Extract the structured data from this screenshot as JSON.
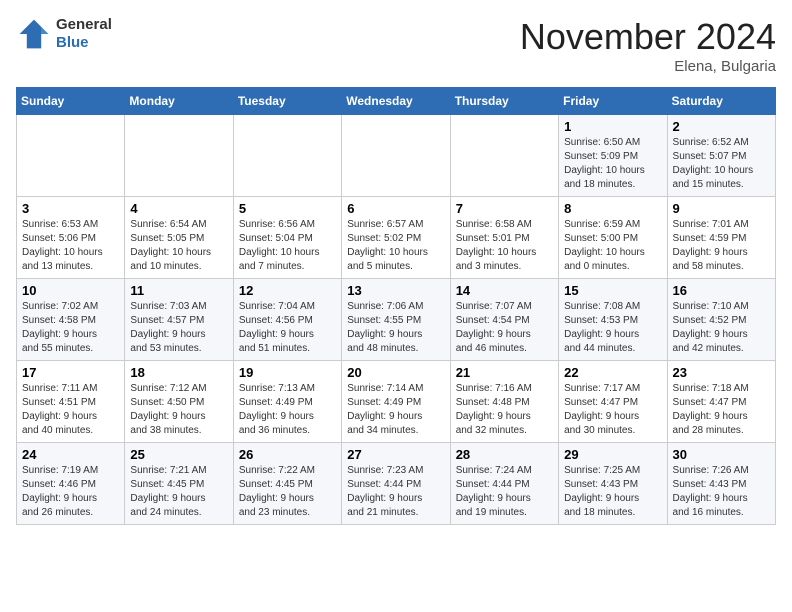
{
  "header": {
    "logo_line1": "General",
    "logo_line2": "Blue",
    "month": "November 2024",
    "location": "Elena, Bulgaria"
  },
  "weekdays": [
    "Sunday",
    "Monday",
    "Tuesday",
    "Wednesday",
    "Thursday",
    "Friday",
    "Saturday"
  ],
  "weeks": [
    [
      {
        "day": "",
        "info": ""
      },
      {
        "day": "",
        "info": ""
      },
      {
        "day": "",
        "info": ""
      },
      {
        "day": "",
        "info": ""
      },
      {
        "day": "",
        "info": ""
      },
      {
        "day": "1",
        "info": "Sunrise: 6:50 AM\nSunset: 5:09 PM\nDaylight: 10 hours\nand 18 minutes."
      },
      {
        "day": "2",
        "info": "Sunrise: 6:52 AM\nSunset: 5:07 PM\nDaylight: 10 hours\nand 15 minutes."
      }
    ],
    [
      {
        "day": "3",
        "info": "Sunrise: 6:53 AM\nSunset: 5:06 PM\nDaylight: 10 hours\nand 13 minutes."
      },
      {
        "day": "4",
        "info": "Sunrise: 6:54 AM\nSunset: 5:05 PM\nDaylight: 10 hours\nand 10 minutes."
      },
      {
        "day": "5",
        "info": "Sunrise: 6:56 AM\nSunset: 5:04 PM\nDaylight: 10 hours\nand 7 minutes."
      },
      {
        "day": "6",
        "info": "Sunrise: 6:57 AM\nSunset: 5:02 PM\nDaylight: 10 hours\nand 5 minutes."
      },
      {
        "day": "7",
        "info": "Sunrise: 6:58 AM\nSunset: 5:01 PM\nDaylight: 10 hours\nand 3 minutes."
      },
      {
        "day": "8",
        "info": "Sunrise: 6:59 AM\nSunset: 5:00 PM\nDaylight: 10 hours\nand 0 minutes."
      },
      {
        "day": "9",
        "info": "Sunrise: 7:01 AM\nSunset: 4:59 PM\nDaylight: 9 hours\nand 58 minutes."
      }
    ],
    [
      {
        "day": "10",
        "info": "Sunrise: 7:02 AM\nSunset: 4:58 PM\nDaylight: 9 hours\nand 55 minutes."
      },
      {
        "day": "11",
        "info": "Sunrise: 7:03 AM\nSunset: 4:57 PM\nDaylight: 9 hours\nand 53 minutes."
      },
      {
        "day": "12",
        "info": "Sunrise: 7:04 AM\nSunset: 4:56 PM\nDaylight: 9 hours\nand 51 minutes."
      },
      {
        "day": "13",
        "info": "Sunrise: 7:06 AM\nSunset: 4:55 PM\nDaylight: 9 hours\nand 48 minutes."
      },
      {
        "day": "14",
        "info": "Sunrise: 7:07 AM\nSunset: 4:54 PM\nDaylight: 9 hours\nand 46 minutes."
      },
      {
        "day": "15",
        "info": "Sunrise: 7:08 AM\nSunset: 4:53 PM\nDaylight: 9 hours\nand 44 minutes."
      },
      {
        "day": "16",
        "info": "Sunrise: 7:10 AM\nSunset: 4:52 PM\nDaylight: 9 hours\nand 42 minutes."
      }
    ],
    [
      {
        "day": "17",
        "info": "Sunrise: 7:11 AM\nSunset: 4:51 PM\nDaylight: 9 hours\nand 40 minutes."
      },
      {
        "day": "18",
        "info": "Sunrise: 7:12 AM\nSunset: 4:50 PM\nDaylight: 9 hours\nand 38 minutes."
      },
      {
        "day": "19",
        "info": "Sunrise: 7:13 AM\nSunset: 4:49 PM\nDaylight: 9 hours\nand 36 minutes."
      },
      {
        "day": "20",
        "info": "Sunrise: 7:14 AM\nSunset: 4:49 PM\nDaylight: 9 hours\nand 34 minutes."
      },
      {
        "day": "21",
        "info": "Sunrise: 7:16 AM\nSunset: 4:48 PM\nDaylight: 9 hours\nand 32 minutes."
      },
      {
        "day": "22",
        "info": "Sunrise: 7:17 AM\nSunset: 4:47 PM\nDaylight: 9 hours\nand 30 minutes."
      },
      {
        "day": "23",
        "info": "Sunrise: 7:18 AM\nSunset: 4:47 PM\nDaylight: 9 hours\nand 28 minutes."
      }
    ],
    [
      {
        "day": "24",
        "info": "Sunrise: 7:19 AM\nSunset: 4:46 PM\nDaylight: 9 hours\nand 26 minutes."
      },
      {
        "day": "25",
        "info": "Sunrise: 7:21 AM\nSunset: 4:45 PM\nDaylight: 9 hours\nand 24 minutes."
      },
      {
        "day": "26",
        "info": "Sunrise: 7:22 AM\nSunset: 4:45 PM\nDaylight: 9 hours\nand 23 minutes."
      },
      {
        "day": "27",
        "info": "Sunrise: 7:23 AM\nSunset: 4:44 PM\nDaylight: 9 hours\nand 21 minutes."
      },
      {
        "day": "28",
        "info": "Sunrise: 7:24 AM\nSunset: 4:44 PM\nDaylight: 9 hours\nand 19 minutes."
      },
      {
        "day": "29",
        "info": "Sunrise: 7:25 AM\nSunset: 4:43 PM\nDaylight: 9 hours\nand 18 minutes."
      },
      {
        "day": "30",
        "info": "Sunrise: 7:26 AM\nSunset: 4:43 PM\nDaylight: 9 hours\nand 16 minutes."
      }
    ]
  ]
}
